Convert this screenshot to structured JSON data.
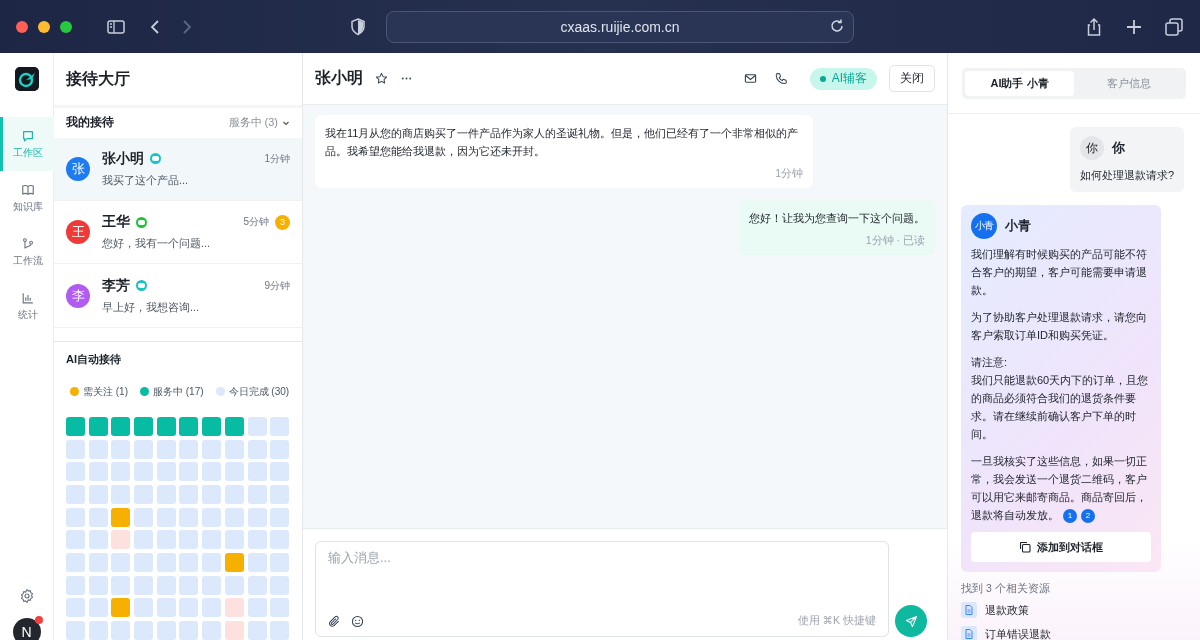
{
  "browser": {
    "url": "cxaas.ruijie.com.cn"
  },
  "nav": {
    "items": [
      {
        "label": "工作区",
        "selected": true
      },
      {
        "label": "知识库",
        "selected": false
      },
      {
        "label": "工作流",
        "selected": false
      },
      {
        "label": "统计",
        "selected": false
      }
    ],
    "user_avatar": "N",
    "user_notification": true
  },
  "left_panel": {
    "title": "接待大厅",
    "section": "我的接待",
    "filter": "服务中 (3)",
    "conversations": [
      {
        "avatar": {
          "text": "张",
          "color": "#1e7cf2"
        },
        "name": "张小明",
        "color": "#17c3c3",
        "time": "1分钟",
        "preview": "我买了这个产品...",
        "selected": true
      },
      {
        "avatar": {
          "text": "王",
          "color": "#f03a3a"
        },
        "name": "王华",
        "color": "#1fc23d",
        "time": "5分钟",
        "preview": "您好，我有一个问题...",
        "unread": "3",
        "selected": false
      },
      {
        "avatar": {
          "text": "李",
          "color": "#b05cf0"
        },
        "name": "李芳",
        "color": "#17c3c3",
        "time": "9分钟",
        "preview": "早上好，我想咨询...",
        "selected": false
      }
    ]
  },
  "auto_service": {
    "title": "AI自动接待",
    "legend": [
      {
        "label": "需关注 (1)",
        "color": "#f5b000"
      },
      {
        "label": "服务中 (17)",
        "color": "#08bca4"
      },
      {
        "label": "今日完成 (30)",
        "color": "#dce8fb"
      }
    ],
    "grid": [
      {
        "kind": "serving"
      },
      {
        "kind": "serving"
      },
      {
        "kind": "serving"
      },
      {
        "kind": "serving"
      },
      {
        "kind": "serving"
      },
      {
        "kind": "serving"
      },
      {
        "kind": "serving"
      },
      {
        "kind": "serving"
      },
      {
        "kind": "done"
      },
      {
        "kind": "done"
      },
      {
        "kind": "done"
      },
      {
        "kind": "done"
      },
      {
        "kind": "done"
      },
      {
        "kind": "done"
      },
      {
        "kind": "done"
      },
      {
        "kind": "done"
      },
      {
        "kind": "done"
      },
      {
        "kind": "done"
      },
      {
        "kind": "done"
      },
      {
        "kind": "done"
      },
      {
        "kind": "done"
      },
      {
        "kind": "done"
      },
      {
        "kind": "done"
      },
      {
        "kind": "done"
      },
      {
        "kind": "done"
      },
      {
        "kind": "done"
      },
      {
        "kind": "done"
      },
      {
        "kind": "done"
      },
      {
        "kind": "done"
      },
      {
        "kind": "done"
      },
      {
        "kind": "done"
      },
      {
        "kind": "done"
      },
      {
        "kind": "done"
      },
      {
        "kind": "done"
      },
      {
        "kind": "done"
      },
      {
        "kind": "done"
      },
      {
        "kind": "done"
      },
      {
        "kind": "done"
      },
      {
        "kind": "done"
      },
      {
        "kind": "done"
      },
      {
        "kind": "done"
      },
      {
        "kind": "done"
      },
      {
        "kind": "attention"
      },
      {
        "kind": "done"
      },
      {
        "kind": "done"
      },
      {
        "kind": "done"
      },
      {
        "kind": "done"
      },
      {
        "kind": "done"
      },
      {
        "kind": "done"
      },
      {
        "kind": "done"
      },
      {
        "kind": "done"
      },
      {
        "kind": "done"
      },
      {
        "kind": "failed"
      },
      {
        "kind": "done"
      },
      {
        "kind": "done"
      },
      {
        "kind": "done"
      },
      {
        "kind": "done"
      },
      {
        "kind": "done"
      },
      {
        "kind": "done"
      },
      {
        "kind": "done"
      },
      {
        "kind": "done"
      },
      {
        "kind": "done"
      },
      {
        "kind": "done"
      },
      {
        "kind": "done"
      },
      {
        "kind": "done"
      },
      {
        "kind": "done"
      },
      {
        "kind": "done"
      },
      {
        "kind": "attention"
      },
      {
        "kind": "done"
      },
      {
        "kind": "done"
      },
      {
        "kind": "done"
      },
      {
        "kind": "done"
      },
      {
        "kind": "done"
      },
      {
        "kind": "done"
      },
      {
        "kind": "done"
      },
      {
        "kind": "done"
      },
      {
        "kind": "done"
      },
      {
        "kind": "done"
      },
      {
        "kind": "done"
      },
      {
        "kind": "done"
      },
      {
        "kind": "done"
      },
      {
        "kind": "done"
      },
      {
        "kind": "attention"
      },
      {
        "kind": "done"
      },
      {
        "kind": "done"
      },
      {
        "kind": "done"
      },
      {
        "kind": "done"
      },
      {
        "kind": "failed"
      },
      {
        "kind": "done"
      },
      {
        "kind": "done"
      },
      {
        "kind": "done"
      },
      {
        "kind": "done"
      },
      {
        "kind": "done"
      },
      {
        "kind": "done"
      },
      {
        "kind": "done"
      },
      {
        "kind": "done"
      },
      {
        "kind": "done"
      },
      {
        "kind": "failed"
      },
      {
        "kind": "done"
      },
      {
        "kind": "done"
      }
    ]
  },
  "chat": {
    "title": "张小明",
    "ai_badge": "AI辅客",
    "close_button": "关闭",
    "messages": [
      {
        "kind": "incoming",
        "text": "我在11月从您的商店购买了一件产品作为家人的圣诞礼物。但是，他们已经有了一个非常相似的产品。我希望您能给我退款，因为它还未开封。",
        "meta": "1分钟"
      },
      {
        "kind": "outgoing",
        "text": "您好！让我为您查询一下这个问题。",
        "meta": "1分钟 · 已读"
      }
    ],
    "input": {
      "placeholder": "输入消息...",
      "hint": "使用 ⌘K 快捷键"
    }
  },
  "right_panel": {
    "tabs": [
      {
        "label": "AI助手 小青",
        "selected": true
      },
      {
        "label": "客户信息",
        "selected": false
      }
    ],
    "user_message": {
      "avatar": "你",
      "name": "你",
      "text": "如何处理退款请求?"
    },
    "ai_message": {
      "avatar": "小青",
      "name": "小青",
      "paragraphs": [
        "我们理解有时候购买的产品可能不符合客户的期望，客户可能需要申请退款。",
        "为了协助客户处理退款请求，请您向客户索取订单ID和购买凭证。",
        "请注意:\n我们只能退款60天内下的订单，且您的商品必须符合我们的退货条件要求。请在继续前确认客户下单的时间。",
        "一旦我核实了这些信息，如果一切正常，我会发送一个退货二维码，客户可以用它来邮寄商品。商品寄回后，退款将自动发放。"
      ],
      "citations": [
        "1",
        "2"
      ],
      "action": "添加到对话框"
    },
    "resources_title": "找到 3 个相关资源",
    "resources": [
      "退款政策",
      "订单错误退款"
    ]
  }
}
